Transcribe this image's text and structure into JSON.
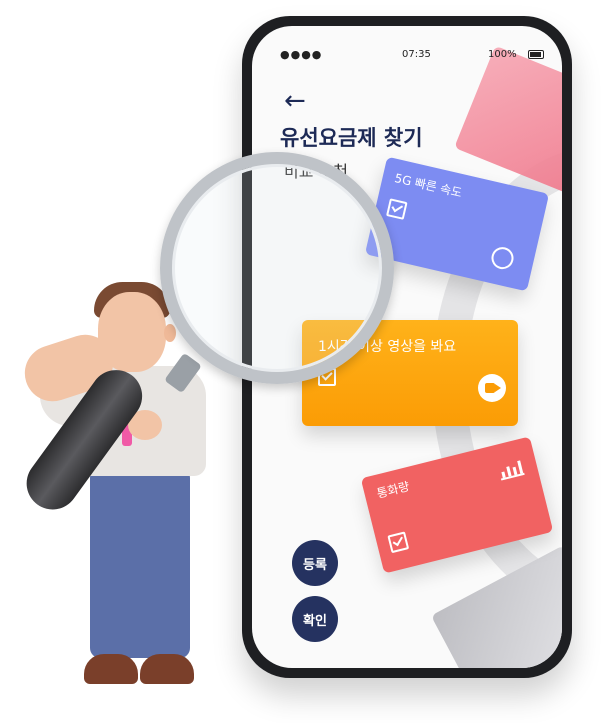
{
  "status_bar": {
    "signal": "●●●●",
    "time": "07:35",
    "battery": "100%"
  },
  "header": {
    "back_icon": "arrow-left-icon",
    "title": "유선요금제 찾기",
    "subtitle": "비교 추천"
  },
  "cards": {
    "speed": {
      "label": "5G 빠른 속도",
      "icon": "stopwatch-icon",
      "color": "#7d8cf2"
    },
    "video": {
      "label": "1시간 이상 영상을 봐요",
      "icon": "video-camera-icon",
      "color": "#fb9c05"
    },
    "calls": {
      "label": "통화량",
      "icon": "bar-chart-icon",
      "color": "#f16262"
    }
  },
  "buttons": {
    "register": "등록",
    "confirm": "확인"
  },
  "colors": {
    "navy": "#1d2a56",
    "button_navy": "#253260",
    "pink_tie": "#f05aa6"
  }
}
